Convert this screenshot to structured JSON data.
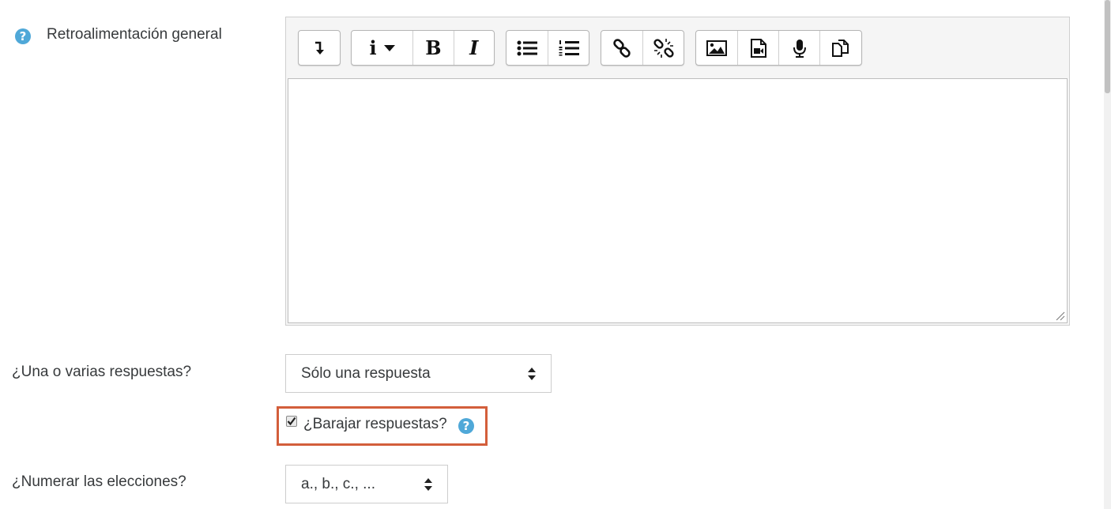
{
  "feedback": {
    "label": "Retroalimentación general",
    "help_icon": "?"
  },
  "editor": {
    "toolbar": [
      [
        "collapse-icon"
      ],
      [
        "paragraph-style-icon",
        "bold-icon",
        "italic-icon"
      ],
      [
        "unordered-list-icon",
        "ordered-list-icon"
      ],
      [
        "link-icon",
        "unlink-icon"
      ],
      [
        "image-icon",
        "video-icon",
        "record-audio-icon",
        "manage-files-icon"
      ]
    ],
    "paragraph_glyph": "i",
    "bold_glyph": "B",
    "italic_glyph": "I"
  },
  "single_answer": {
    "label": "¿Una o varias respuestas?",
    "value": "Sólo una respuesta"
  },
  "shuffle": {
    "label": "¿Barajar respuestas?",
    "checked": true,
    "help_icon": "?"
  },
  "numbering": {
    "label": "¿Numerar las elecciones?",
    "value": "a., b., c., ..."
  },
  "colors": {
    "highlight": "#d35e3b",
    "help": "#4fa8d8"
  }
}
